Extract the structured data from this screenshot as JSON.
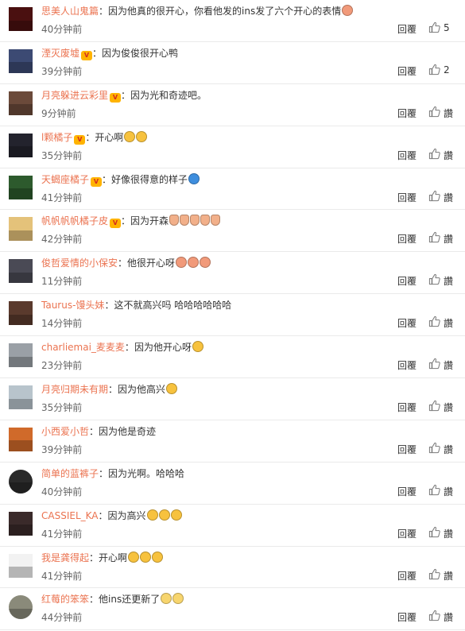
{
  "reply_label": "回覆",
  "like_label": "讚",
  "comments": [
    {
      "username": "思美人山鬼篇",
      "badge": false,
      "text": "因为他真的很开心，你看他发的ins发了六个开心的表情",
      "emojis": [
        "#f19a7a"
      ],
      "emoji_icons": [
        "happy-face-emoji-icon"
      ],
      "time": "40分钟前",
      "likes": "5",
      "avatar_color": "#4a1010",
      "round": false
    },
    {
      "username": "湮灭废墟",
      "badge": true,
      "text": "因为俊俊很开心鸭",
      "emojis": [],
      "emoji_icons": [],
      "time": "39分钟前",
      "likes": "2",
      "avatar_color": "#3c4a73",
      "round": false
    },
    {
      "username": "月亮躲进云彩里",
      "badge": true,
      "text": "因为光和奇迹吧。",
      "emojis": [],
      "emoji_icons": [],
      "time": "9分钟前",
      "likes": "讚",
      "avatar_color": "#6b4a3a",
      "round": false
    },
    {
      "username": "l颗橘子",
      "badge": true,
      "text": "开心啊",
      "emojis": [
        "#f7c23e",
        "#f7c23e"
      ],
      "emoji_icons": [
        "smile-emoji-icon",
        "smile-emoji-icon"
      ],
      "time": "35分钟前",
      "likes": "讚",
      "avatar_color": "#23232d",
      "round": false
    },
    {
      "username": "天蝎座橘子",
      "badge": true,
      "text": "好像很得意的样子",
      "emojis": [
        "#3e8ede"
      ],
      "emoji_icons": [
        "doraemon-emoji-icon"
      ],
      "time": "41分钟前",
      "likes": "讚",
      "avatar_color": "#2d5a2d",
      "round": false
    },
    {
      "username": "帆帆帆帆橘子皮",
      "badge": true,
      "text": "因为开森",
      "emojis": [
        "#f2b08a",
        "#f2b08a",
        "#f2b08a",
        "#f2b08a",
        "#f2b08a"
      ],
      "emoji_icons": [
        "thumbs-up-emoji-icon",
        "thumbs-up-emoji-icon",
        "thumbs-up-emoji-icon",
        "thumbs-up-emoji-icon",
        "thumbs-up-emoji-icon"
      ],
      "time": "42分钟前",
      "likes": "讚",
      "avatar_color": "#e4c27a",
      "round": false
    },
    {
      "username": "俊哲爱情的小保安",
      "badge": false,
      "text": "他很开心呀",
      "emojis": [
        "#f19a7a",
        "#f19a7a",
        "#f19a7a"
      ],
      "emoji_icons": [
        "happy-face-emoji-icon",
        "happy-face-emoji-icon",
        "happy-face-emoji-icon"
      ],
      "time": "11分钟前",
      "likes": "讚",
      "avatar_color": "#4a4a55",
      "round": false
    },
    {
      "username": "Taurus-馒头妹",
      "badge": false,
      "text": "这不就高兴吗 哈哈哈哈哈哈",
      "emojis": [],
      "emoji_icons": [],
      "time": "14分钟前",
      "likes": "讚",
      "avatar_color": "#5a3a2d",
      "round": false
    },
    {
      "username": "charliemai_麦麦麦",
      "badge": false,
      "text": "因为他开心呀",
      "emojis": [
        "#f7c23e"
      ],
      "emoji_icons": [
        "laugh-cry-emoji-icon"
      ],
      "time": "23分钟前",
      "likes": "讚",
      "avatar_color": "#9aa0a6",
      "round": false
    },
    {
      "username": "月亮归期未有期",
      "badge": false,
      "text": "因为他高兴",
      "emojis": [
        "#f7c23e"
      ],
      "emoji_icons": [
        "shocked-emoji-icon"
      ],
      "time": "35分钟前",
      "likes": "讚",
      "avatar_color": "#b8c4cc",
      "round": false
    },
    {
      "username": "小西爱小哲",
      "badge": false,
      "text": "因为他是奇迹",
      "emojis": [],
      "emoji_icons": [],
      "time": "39分钟前",
      "likes": "讚",
      "avatar_color": "#d06a2a",
      "round": false
    },
    {
      "username": "简单的蓝裤子",
      "badge": false,
      "text": "因为光啊。哈哈哈",
      "emojis": [],
      "emoji_icons": [],
      "time": "40分钟前",
      "likes": "讚",
      "avatar_color": "#2a2a2a",
      "round": true
    },
    {
      "username": "CASSIEL_KA",
      "badge": false,
      "text": "因为高兴",
      "emojis": [
        "#f7c23e",
        "#f7c23e",
        "#f7c23e"
      ],
      "emoji_icons": [
        "star-face-emoji-icon",
        "star-face-emoji-icon",
        "star-face-emoji-icon"
      ],
      "time": "41分钟前",
      "likes": "讚",
      "avatar_color": "#3a2a2a",
      "round": false
    },
    {
      "username": "我是龚得起",
      "badge": false,
      "text": "开心啊",
      "emojis": [
        "#f7c23e",
        "#f7c23e",
        "#f7c23e"
      ],
      "emoji_icons": [
        "sad-face-emoji-icon",
        "sad-face-emoji-icon",
        "sad-face-emoji-icon"
      ],
      "time": "41分钟前",
      "likes": "讚",
      "avatar_color": "#f2f2f2",
      "round": false
    },
    {
      "username": "红莓的笨笨",
      "badge": false,
      "text": "他ins还更新了",
      "emojis": [
        "#f7d56e",
        "#f7d56e"
      ],
      "emoji_icons": [
        "smile-emoji-icon",
        "smile-emoji-icon"
      ],
      "time": "44分钟前",
      "likes": "讚",
      "avatar_color": "#8a8a7a",
      "round": true
    }
  ]
}
